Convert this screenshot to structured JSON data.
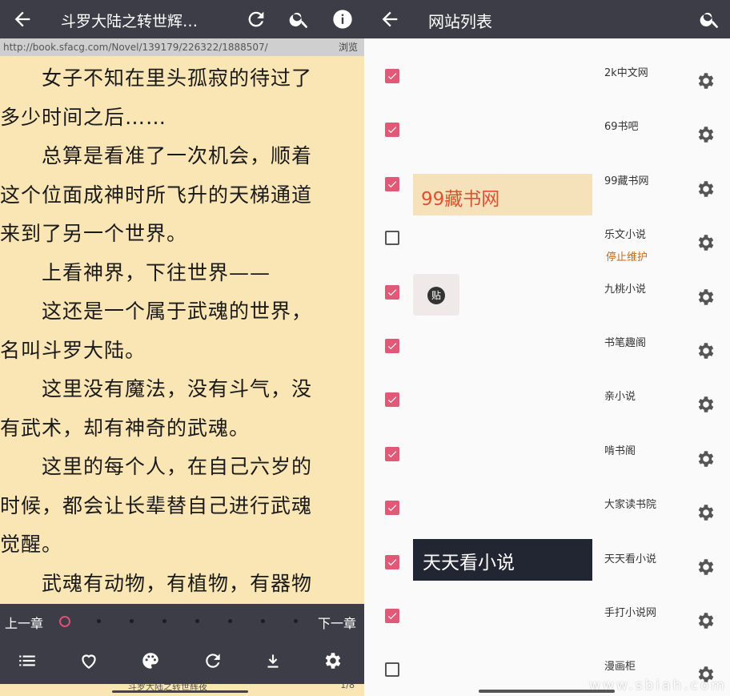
{
  "reader": {
    "title": "斗罗大陆之转世辉…",
    "url": "http://book.sfacg.com/Novel/139179/226322/1888507/",
    "browse_label": "浏览",
    "lines": [
      "　　女子不知在里头孤寂的待过了",
      "多少时间之后……",
      "　　总算是看准了一次机会，顺着",
      "这个位面成神时所飞升的天梯通道",
      "来到了另一个世界。",
      "　　上看神界，下往世界——",
      "　　这还是一个属于武魂的世界，",
      "名叫斗罗大陆。",
      "　　这里没有魔法，没有斗气，没",
      "有武术，却有神奇的武魂。",
      "　　这里的每个人，在自己六岁的",
      "时候，都会让长辈替自己进行武魂",
      "觉醒。",
      "　　武魂有动物，有植物，有器物"
    ],
    "prev_chapter": "上一章",
    "next_chapter": "下一章",
    "chapter_progress": 0.0,
    "status_title": "斗罗大陆之转世辉夜",
    "status_page": "1/8",
    "icons": [
      "back-arrow-icon",
      "refresh-icon",
      "search-icon",
      "info-icon",
      "list-icon",
      "heart-icon",
      "palette-icon",
      "refresh-icon",
      "download-icon",
      "gear-icon"
    ]
  },
  "sites": {
    "title": "网站列表",
    "accent": "#e05a78",
    "items": [
      {
        "name": "2k中文网",
        "checked": true,
        "note": "",
        "banner": ""
      },
      {
        "name": "69书吧",
        "checked": true,
        "note": "",
        "banner": ""
      },
      {
        "name": "99藏书网",
        "checked": true,
        "note": "",
        "banner": "99藏书网"
      },
      {
        "name": "乐文小说",
        "checked": false,
        "note": "停止维护",
        "banner": ""
      },
      {
        "name": "九桃小说",
        "checked": true,
        "note": "",
        "banner": "贴"
      },
      {
        "name": "书笔趣阁",
        "checked": true,
        "note": "",
        "banner": ""
      },
      {
        "name": "亲小说",
        "checked": true,
        "note": "",
        "banner": ""
      },
      {
        "name": "啃书阁",
        "checked": true,
        "note": "",
        "banner": ""
      },
      {
        "name": "大家读书院",
        "checked": true,
        "note": "",
        "banner": ""
      },
      {
        "name": "天天看小说",
        "checked": true,
        "note": "",
        "banner": "天天看小说"
      },
      {
        "name": "手打小说网",
        "checked": true,
        "note": "",
        "banner": ""
      },
      {
        "name": "漫画柜",
        "checked": false,
        "note": "",
        "banner": ""
      }
    ]
  },
  "watermark": "www.sbiah.com"
}
